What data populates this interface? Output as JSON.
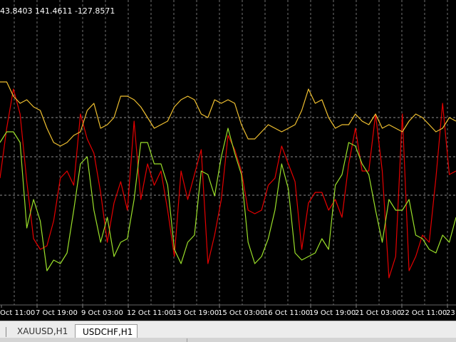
{
  "window": {
    "readout": "43.8403 141.4611 -127.8571"
  },
  "tabs": [
    {
      "label": "XAUUSD,H1",
      "active": false
    },
    {
      "label": "USDCHF,H1",
      "active": true
    }
  ],
  "colors": {
    "background": "#000000",
    "grid": "#bfbfbf",
    "red": "#e60000",
    "green": "#9be02a",
    "gold": "#f0c030",
    "axis_text": "#ffffff"
  },
  "chart_data": {
    "type": "line",
    "grid": true,
    "horizontal_levels": [
      "upper",
      "middle",
      "lower"
    ],
    "x_ticks": [
      "Oct 11:00",
      "7 Oct 19:00",
      "9 Oct 03:00",
      "12 Oct 11:00",
      "13 Oct 19:00",
      "15 Oct 03:00",
      "16 Oct 11:00",
      "19 Oct 19:00",
      "21 Oct 03:00",
      "22 Oct 11:00",
      "23"
    ],
    "series": [
      {
        "color": "red",
        "values": [
          -30,
          40,
          95,
          60,
          -35,
          -115,
          -130,
          -125,
          -90,
          -30,
          -20,
          -40,
          60,
          25,
          5,
          -50,
          -120,
          -65,
          -35,
          -75,
          50,
          -60,
          -10,
          -40,
          -20,
          -75,
          -140,
          -20,
          -60,
          -25,
          10,
          -150,
          -110,
          -60,
          30,
          10,
          -20,
          -75,
          -80,
          -75,
          -40,
          -30,
          15,
          -10,
          -35,
          -130,
          -65,
          -50,
          -50,
          -75,
          -60,
          -85,
          -10,
          40,
          -20,
          -20,
          60,
          -20,
          -170,
          -140,
          60,
          -160,
          -140,
          -110,
          -120,
          -30,
          75,
          -25,
          -20
        ]
      },
      {
        "color": "green",
        "values": [
          20,
          35,
          35,
          20,
          -100,
          -60,
          -90,
          -160,
          -145,
          -150,
          -135,
          -75,
          -10,
          0,
          -75,
          -120,
          -85,
          -140,
          -120,
          -115,
          -60,
          20,
          20,
          -10,
          -10,
          -40,
          -130,
          -150,
          -120,
          -110,
          -20,
          -25,
          -55,
          0,
          40,
          5,
          -25,
          -120,
          -150,
          -140,
          -115,
          -75,
          -10,
          -45,
          -135,
          -145,
          -140,
          -135,
          -115,
          -130,
          -40,
          -25,
          20,
          15,
          -10,
          -25,
          -75,
          -120,
          -60,
          -75,
          -75,
          -60,
          -110,
          -115,
          -130,
          -135,
          -110,
          -120,
          -85
        ]
      },
      {
        "color": "gold",
        "values": [
          105,
          105,
          85,
          75,
          80,
          70,
          65,
          40,
          20,
          15,
          20,
          30,
          35,
          65,
          75,
          40,
          45,
          55,
          85,
          85,
          80,
          70,
          55,
          40,
          45,
          50,
          70,
          80,
          85,
          80,
          60,
          55,
          80,
          75,
          80,
          75,
          45,
          25,
          25,
          35,
          45,
          40,
          35,
          40,
          45,
          65,
          95,
          75,
          80,
          55,
          40,
          45,
          45,
          60,
          50,
          45,
          60,
          40,
          45,
          40,
          35,
          50,
          60,
          55,
          45,
          35,
          40,
          55,
          50
        ]
      }
    ]
  }
}
